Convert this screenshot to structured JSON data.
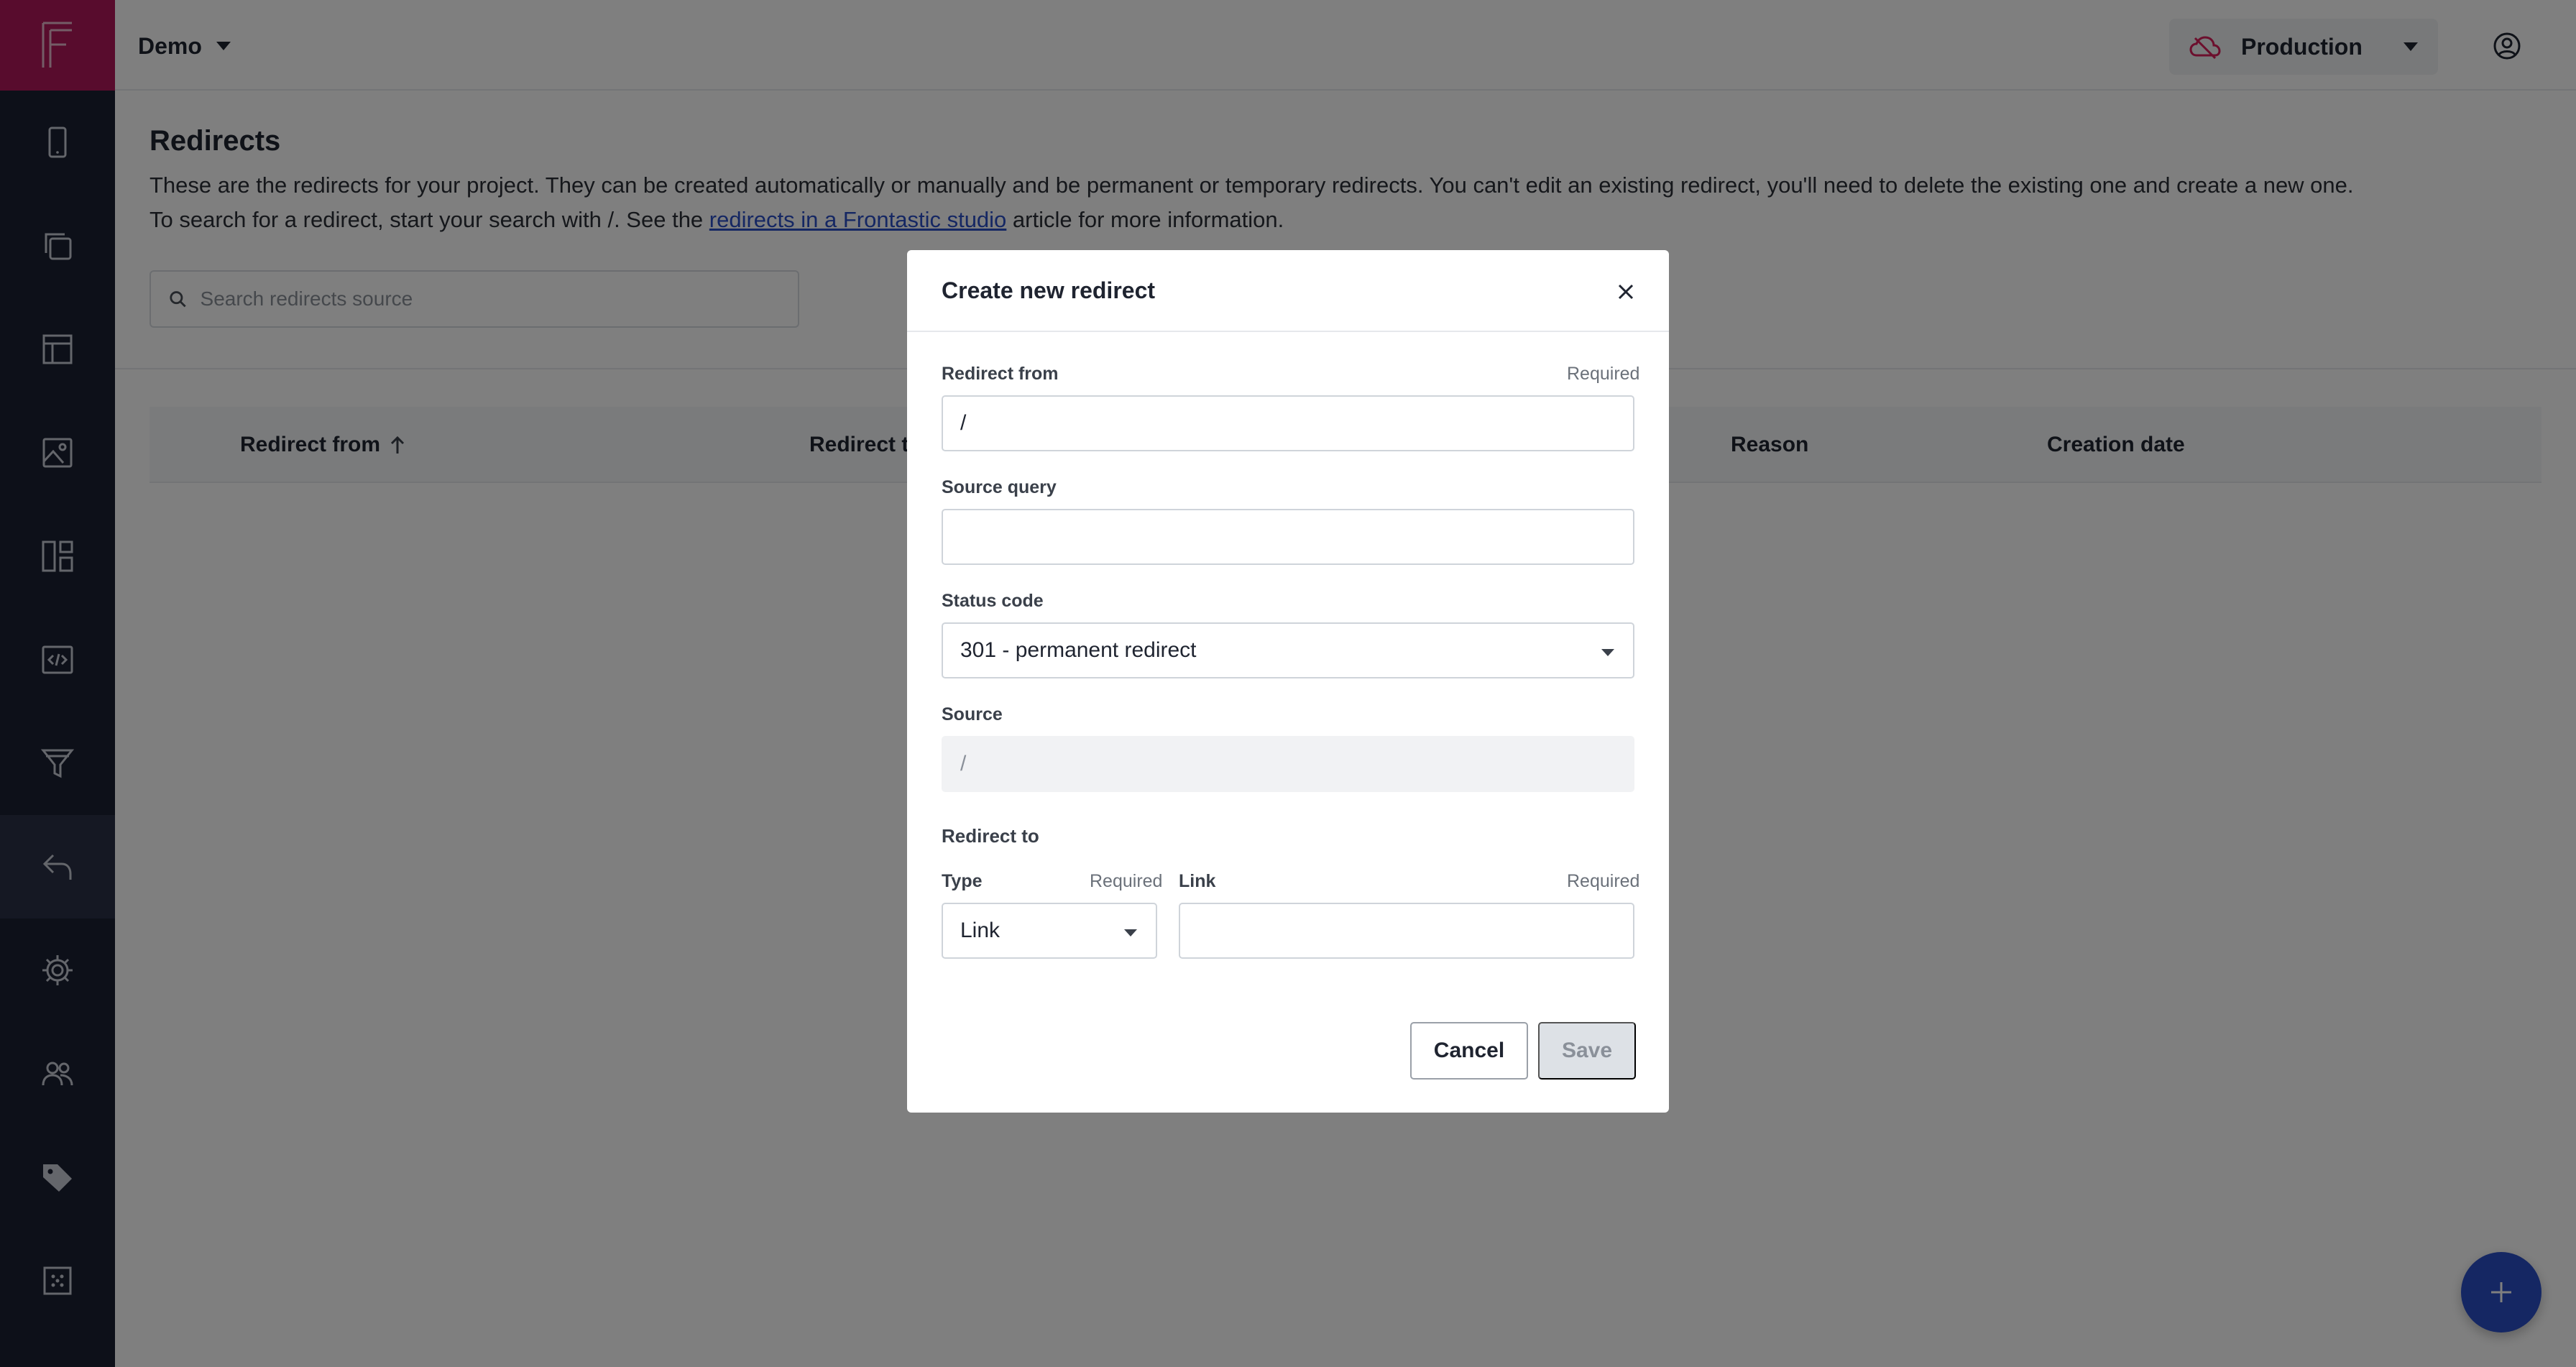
{
  "topbar": {
    "project": "Demo",
    "environment": "Production",
    "environment_icon_color": "#d81e5b"
  },
  "sidebar": {
    "items": [
      {
        "icon": "mobile-icon"
      },
      {
        "icon": "pages-icon"
      },
      {
        "icon": "layout-icon"
      },
      {
        "icon": "media-icon"
      },
      {
        "icon": "components-icon"
      },
      {
        "icon": "code-icon"
      },
      {
        "icon": "filter-icon"
      },
      {
        "icon": "redirect-icon",
        "active": true
      },
      {
        "icon": "settings-icon"
      },
      {
        "icon": "users-icon"
      },
      {
        "icon": "tag-icon"
      },
      {
        "icon": "developer-icon"
      }
    ]
  },
  "page": {
    "title": "Redirects",
    "desc_line1": "These are the redirects for your project. They can be created automatically or manually and be permanent or temporary redirects. You can't edit an existing redirect, you'll need to delete the existing one and create a new one.",
    "desc_line2_before": "To search for a redirect, start your search with /. See the ",
    "desc_link": "redirects in a Frontastic studio",
    "desc_line2_after": " article for more information.",
    "search_placeholder": "Search redirects source"
  },
  "table": {
    "columns": [
      "Redirect from",
      "Redirect to",
      "Reason",
      "Creation date"
    ]
  },
  "modal": {
    "title": "Create new redirect",
    "redirect_from_label": "Redirect from",
    "required": "Required",
    "redirect_from_value": "/",
    "source_query_label": "Source query",
    "source_query_value": "",
    "status_code_label": "Status code",
    "status_code_value": "301 - permanent redirect",
    "source_label": "Source",
    "source_value": "/",
    "redirect_to_label": "Redirect to",
    "type_label": "Type",
    "type_value": "Link",
    "link_label": "Link",
    "link_value": "",
    "cancel": "Cancel",
    "save": "Save"
  },
  "colors": {
    "accent": "#2b4fc7",
    "brand": "#b0195a",
    "sidebar": "#1b2033"
  }
}
